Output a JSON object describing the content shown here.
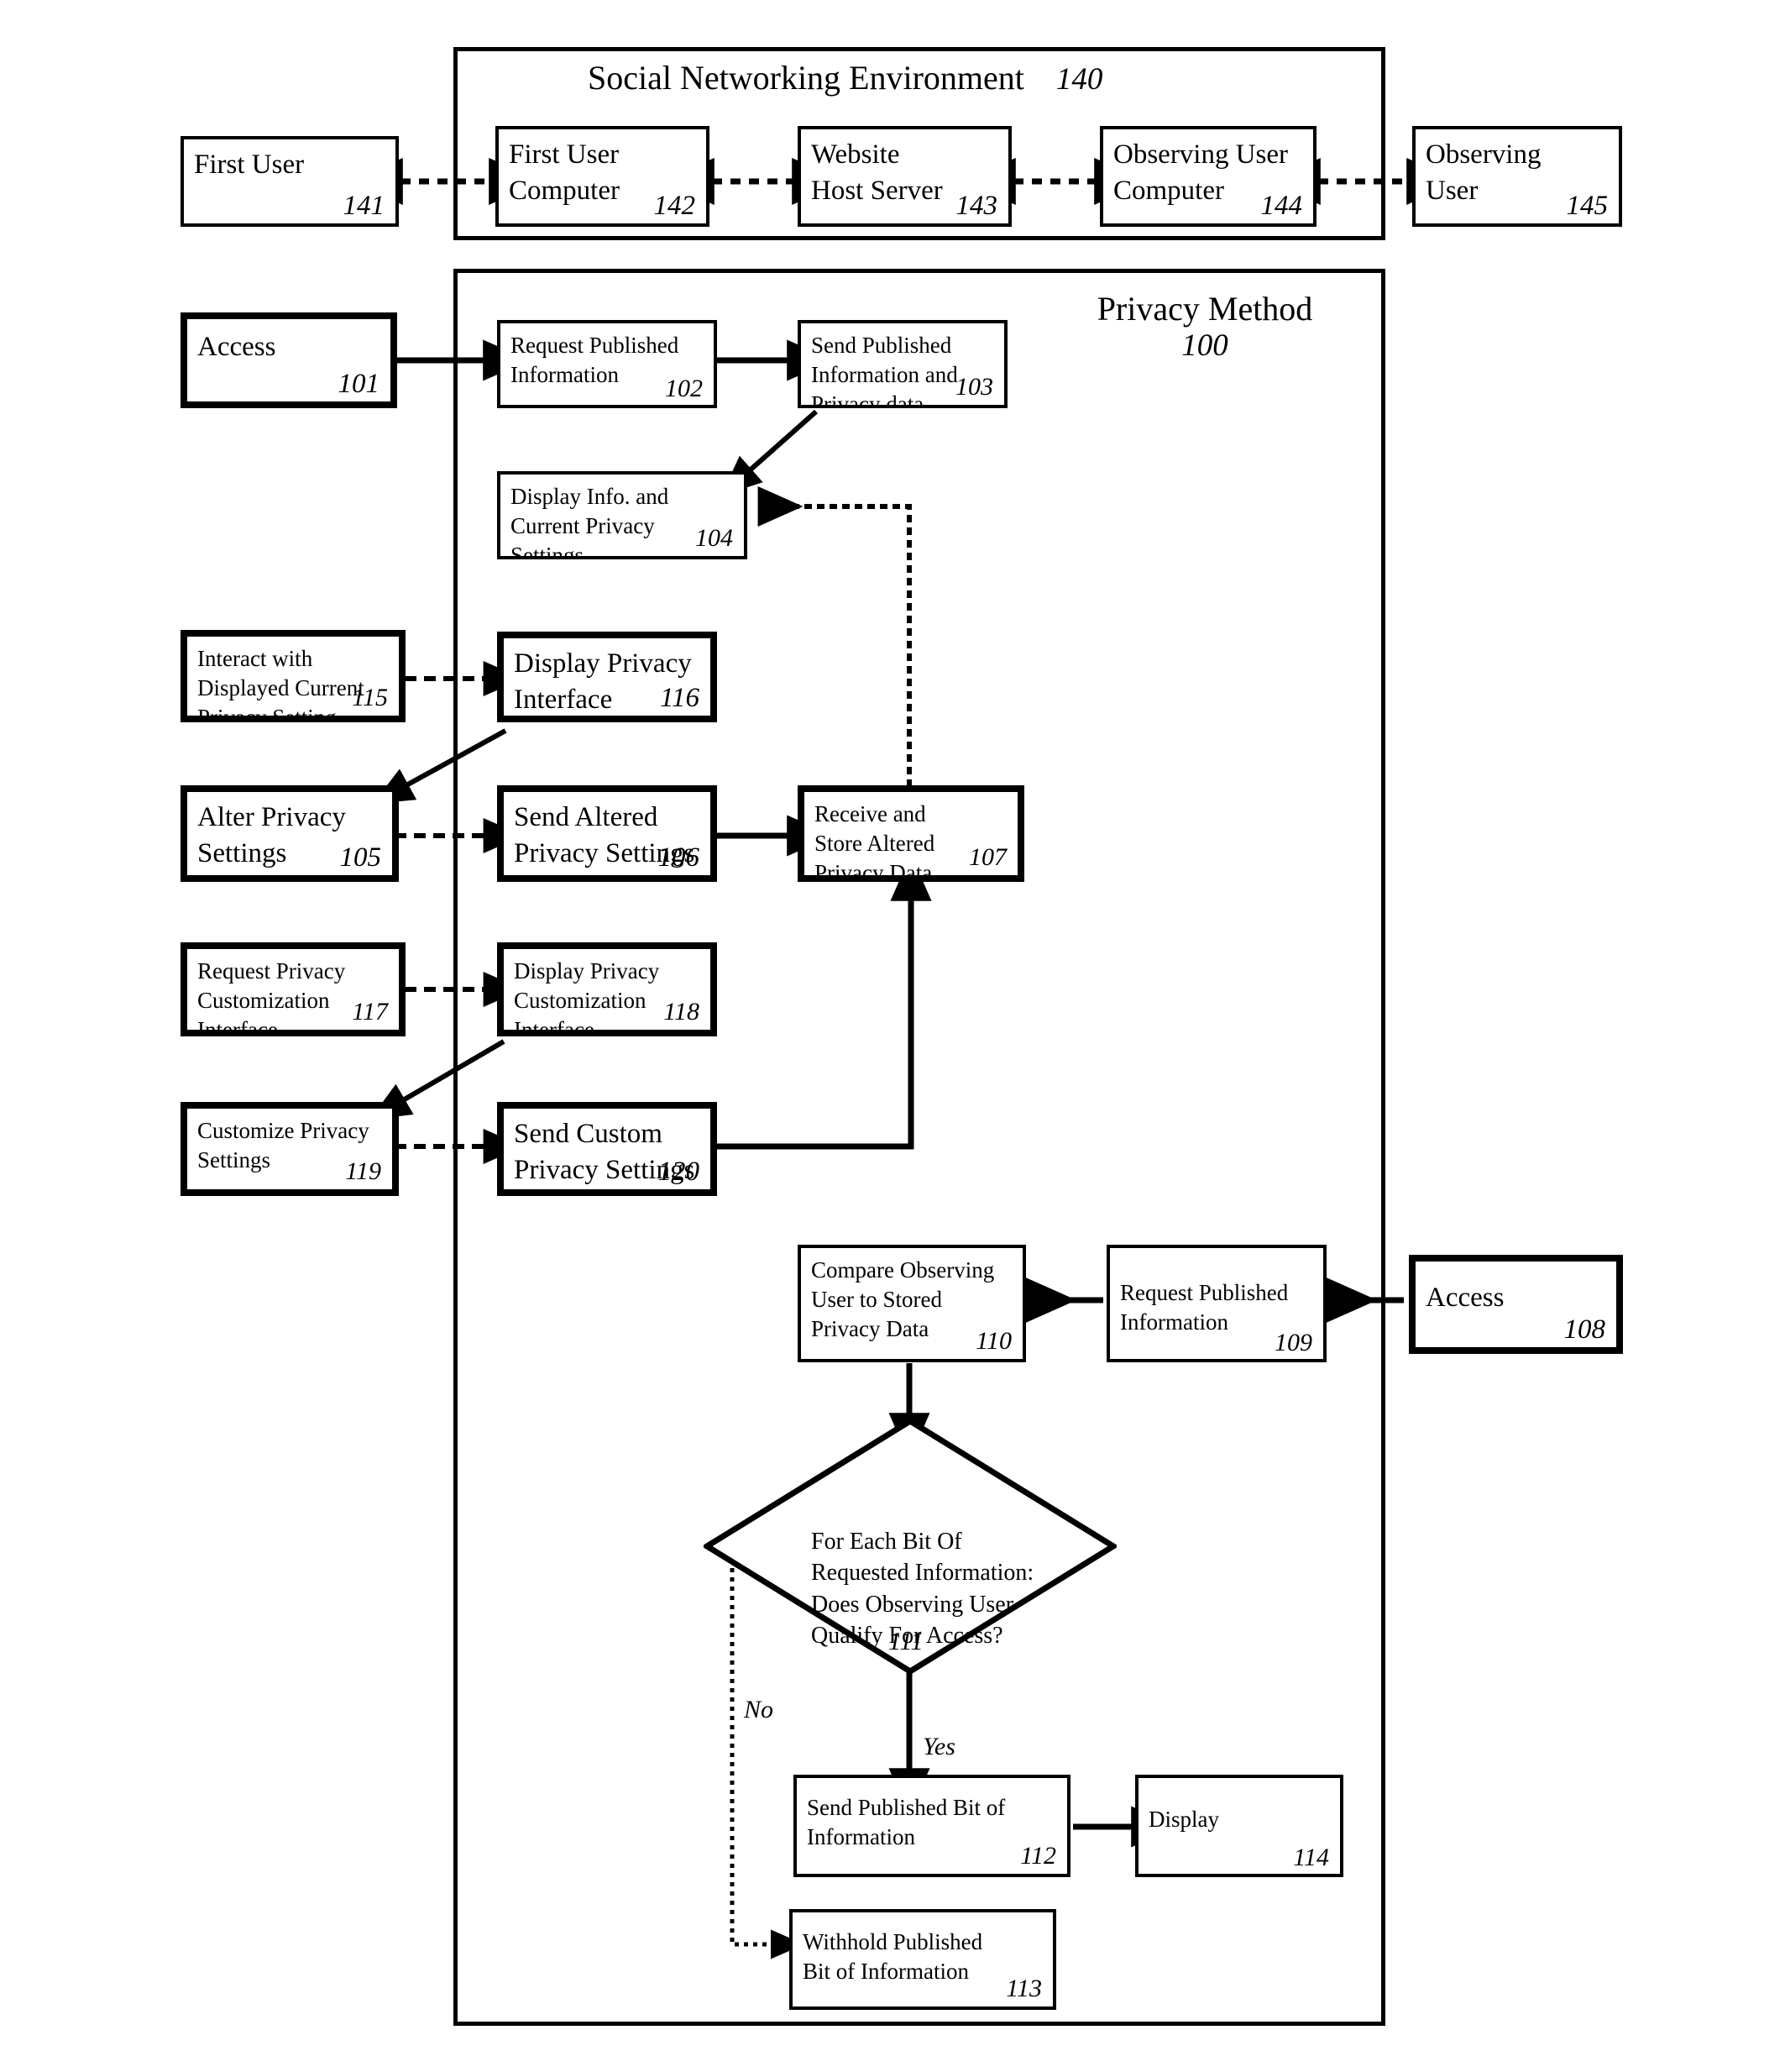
{
  "figure": {
    "kind": "patent-flowchart",
    "containers": [
      {
        "id": "social-networking-environment",
        "title": "Social Networking Environment",
        "number": "140"
      },
      {
        "id": "privacy-method",
        "title": "Privacy Method",
        "number": "100"
      }
    ]
  },
  "environment_nodes": [
    {
      "id": "n141",
      "label": "First User",
      "number": "141"
    },
    {
      "id": "n142",
      "label": "First User\nComputer",
      "number": "142"
    },
    {
      "id": "n143",
      "label": "Website\nHost Server",
      "number": "143"
    },
    {
      "id": "n144",
      "label": "Observing User\nComputer",
      "number": "144"
    },
    {
      "id": "n145",
      "label": "Observing\nUser",
      "number": "145"
    }
  ],
  "method_nodes": [
    {
      "id": "n101",
      "label": "Access",
      "number": "101"
    },
    {
      "id": "n102",
      "label": "Request Published\nInformation",
      "number": "102"
    },
    {
      "id": "n103",
      "label": "Send Published\nInformation and\nPrivacy data",
      "number": "103"
    },
    {
      "id": "n104",
      "label": "Display Info. and\nCurrent Privacy\nSettings",
      "number": "104"
    },
    {
      "id": "n115",
      "label": "Interact with\nDisplayed Current\nPrivacy Setting",
      "number": "115"
    },
    {
      "id": "n116",
      "label": "Display Privacy\nInterface",
      "number": "116"
    },
    {
      "id": "n105",
      "label": "Alter Privacy\nSettings",
      "number": "105"
    },
    {
      "id": "n106",
      "label": "Send Altered\nPrivacy Settings",
      "number": "106"
    },
    {
      "id": "n107",
      "label": "Receive and\nStore Altered\nPrivacy Data",
      "number": "107"
    },
    {
      "id": "n117",
      "label": "Request Privacy\nCustomization\nInterface",
      "number": "117"
    },
    {
      "id": "n118",
      "label": "Display Privacy\nCustomization\nInterface",
      "number": "118"
    },
    {
      "id": "n119",
      "label": "Customize Privacy\nSettings",
      "number": "119"
    },
    {
      "id": "n120",
      "label": "Send Custom\nPrivacy Settings",
      "number": "120"
    },
    {
      "id": "n110",
      "label": "Compare Observing\nUser to Stored\nPrivacy Data",
      "number": "110"
    },
    {
      "id": "n109",
      "label": "Request Published\nInformation",
      "number": "109"
    },
    {
      "id": "n108",
      "label": "Access",
      "number": "108"
    },
    {
      "id": "n112",
      "label": "Send Published Bit of\nInformation",
      "number": "112"
    },
    {
      "id": "n114",
      "label": "Display",
      "number": "114"
    },
    {
      "id": "n113",
      "label": "Withhold Published\nBit of Information",
      "number": "113"
    }
  ],
  "decision": {
    "id": "n111",
    "label": "For Each Bit Of\nRequested Information:\nDoes Observing User\nQualify For Access?",
    "number": "111",
    "branches": [
      {
        "id": "branch-no",
        "label": "No"
      },
      {
        "id": "branch-yes",
        "label": "Yes"
      }
    ]
  },
  "colors": {
    "ink": "#000000",
    "paper": "#ffffff"
  }
}
